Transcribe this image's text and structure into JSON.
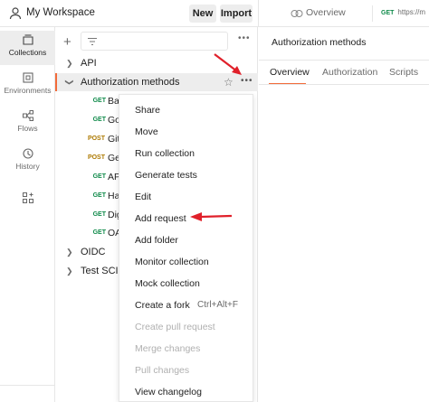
{
  "header": {
    "workspace": "My Workspace",
    "new_label": "New",
    "import_label": "Import",
    "overview_tab": "Overview",
    "get_tab_method": "GET",
    "get_tab_url": "https://m"
  },
  "rail": {
    "collections": "Collections",
    "environments": "Environments",
    "flows": "Flows",
    "history": "History"
  },
  "tree": {
    "api": "API",
    "auth_methods": "Authorization methods",
    "requests": [
      {
        "method": "GET",
        "name": "Ba"
      },
      {
        "method": "GET",
        "name": "Go"
      },
      {
        "method": "POST",
        "name": "Git"
      },
      {
        "method": "POST",
        "name": "Ge"
      },
      {
        "method": "GET",
        "name": "AP"
      },
      {
        "method": "GET",
        "name": "Ha"
      },
      {
        "method": "GET",
        "name": "Dig"
      },
      {
        "method": "GET",
        "name": "OA"
      }
    ],
    "oidc": "OIDC",
    "test_scim": "Test SCIM"
  },
  "right_panel": {
    "title": "Authorization methods",
    "tabs": [
      "Overview",
      "Authorization",
      "Scripts"
    ]
  },
  "menu": {
    "items": [
      {
        "label": "Share",
        "disabled": false
      },
      {
        "label": "Move",
        "disabled": false
      },
      {
        "label": "Run collection",
        "disabled": false
      },
      {
        "label": "Generate tests",
        "disabled": false
      },
      {
        "label": "Edit",
        "disabled": false
      },
      {
        "label": "Add request",
        "disabled": false
      },
      {
        "label": "Add folder",
        "disabled": false
      },
      {
        "label": "Monitor collection",
        "disabled": false
      },
      {
        "label": "Mock collection",
        "disabled": false
      },
      {
        "label": "Create a fork",
        "disabled": false,
        "shortcut": "Ctrl+Alt+F"
      },
      {
        "label": "Create pull request",
        "disabled": true
      },
      {
        "label": "Merge changes",
        "disabled": true
      },
      {
        "label": "Pull changes",
        "disabled": true
      },
      {
        "label": "View changelog",
        "disabled": false
      }
    ]
  },
  "colors": {
    "accent": "#f26b3a",
    "annotation_arrow": "#e0202a",
    "get": "#0f8a4a",
    "post": "#ad7a03"
  }
}
